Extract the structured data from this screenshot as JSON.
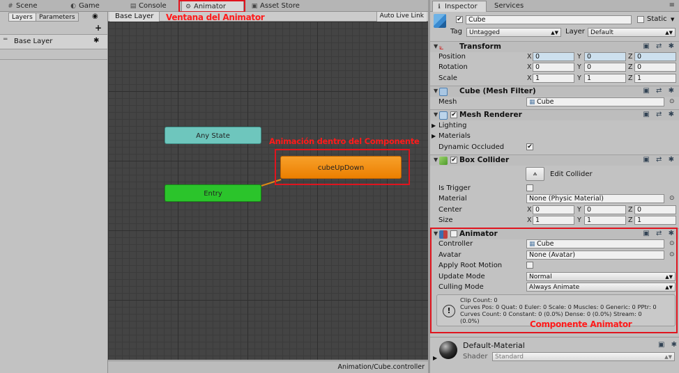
{
  "tabs": {
    "scene": "Scene",
    "game": "Game",
    "console": "Console",
    "animator": "Animator",
    "asset_store": "Asset Store",
    "inspector": "Inspector",
    "services": "Services"
  },
  "left_panel": {
    "layers_tab": "Layers",
    "parameters_tab": "Parameters",
    "add": "+",
    "layer_name": "Base Layer"
  },
  "graph": {
    "breadcrumb": "Base Layer",
    "auto_live_link": "Auto Live Link",
    "states": {
      "any_state": "Any State",
      "entry": "Entry",
      "cube_up_down": "cubeUpDown"
    },
    "footer_path": "Animation/Cube.controller"
  },
  "annotations": {
    "window_label": "Ventana del Animator",
    "state_label": "Animación dentro del Componente",
    "component_label": "Componente Animator"
  },
  "inspector": {
    "object": {
      "name": "Cube",
      "static_label": "Static",
      "tag_label": "Tag",
      "tag_value": "Untagged",
      "layer_label": "Layer",
      "layer_value": "Default"
    },
    "transform": {
      "title": "Transform",
      "position_label": "Position",
      "rotation_label": "Rotation",
      "scale_label": "Scale",
      "x": "X",
      "y": "Y",
      "z": "Z",
      "position": [
        "0",
        "0",
        "0"
      ],
      "rotation": [
        "0",
        "0",
        "0"
      ],
      "scale": [
        "1",
        "1",
        "1"
      ]
    },
    "mesh_filter": {
      "title": "Cube (Mesh Filter)",
      "mesh_label": "Mesh",
      "mesh_value": "Cube"
    },
    "mesh_renderer": {
      "title": "Mesh Renderer",
      "lighting": "Lighting",
      "materials": "Materials",
      "dynamic_occluded": "Dynamic Occluded"
    },
    "box_collider": {
      "title": "Box Collider",
      "edit_collider": "Edit Collider",
      "is_trigger": "Is Trigger",
      "material_label": "Material",
      "material_value": "None (Physic Material)",
      "center_label": "Center",
      "size_label": "Size",
      "center": [
        "0",
        "0",
        "0"
      ],
      "size": [
        "1",
        "1",
        "1"
      ]
    },
    "animator": {
      "title": "Animator",
      "controller_label": "Controller",
      "controller_value": "Cube",
      "avatar_label": "Avatar",
      "avatar_value": "None (Avatar)",
      "apply_root_motion": "Apply Root Motion",
      "update_mode_label": "Update Mode",
      "update_mode_value": "Normal",
      "culling_mode_label": "Culling Mode",
      "culling_mode_value": "Always Animate",
      "info_line1": "Clip Count: 0",
      "info_line2": "Curves Pos: 0 Quat: 0 Euler: 0 Scale: 0 Muscles: 0 Generic: 0 PPtr: 0",
      "info_line3": "Curves Count: 0 Constant: 0 (0.0%) Dense: 0 (0.0%) Stream: 0",
      "info_line4": "(0.0%)"
    },
    "material": {
      "name": "Default-Material",
      "shader_label": "Shader",
      "shader_value": "Standard"
    }
  },
  "colors": {
    "any_state": "#6ec6bd",
    "entry": "#2bc42b",
    "state_orange": "#f28c0a",
    "annotation_red": "#e0141e"
  }
}
